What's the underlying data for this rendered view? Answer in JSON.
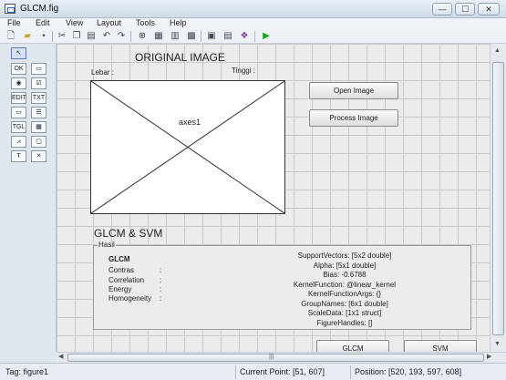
{
  "window": {
    "title": "GLCM.fig",
    "minimize_glyph": "—",
    "maximize_glyph": "☐",
    "close_glyph": "✕"
  },
  "menu": [
    "File",
    "Edit",
    "View",
    "Layout",
    "Tools",
    "Help"
  ],
  "toolbar": {
    "icons": [
      "new-icon",
      "open-icon",
      "save-icon",
      "cut-icon",
      "copy-icon",
      "paste-icon",
      "undo-icon",
      "redo-icon",
      "align-icon",
      "menu-editor-icon",
      "tab-order-icon",
      "toolbar-editor-icon",
      "mfile-editor-icon",
      "property-inspector-icon",
      "object-browser-icon",
      "run-icon"
    ]
  },
  "palette": {
    "items": [
      "select-tool",
      "push-button",
      "slider",
      "radio-button",
      "checkbox",
      "edit-text",
      "static-text",
      "popup-menu",
      "listbox",
      "toggle-button",
      "table",
      "axes",
      "panel",
      "button-group",
      "activex-control"
    ]
  },
  "canvas": {
    "original_image_title": "ORIGINAL IMAGE",
    "lebar_label": "Lebar :",
    "tinggi_label": "Tinggi :",
    "axes_label": "axes1",
    "open_image_button": "Open Image",
    "process_image_button": "Process Image",
    "glcm_svm_title": "GLCM & SVM",
    "hasil_panel": {
      "legend": "Hasil",
      "glcm_heading": "GLCM",
      "features": [
        {
          "name": "Contras",
          "colon": ":"
        },
        {
          "name": "Correlation",
          "colon": ":"
        },
        {
          "name": "Energy",
          "colon": ":"
        },
        {
          "name": "Homogeneity",
          "colon": ":"
        }
      ],
      "svm_lines": [
        "SupportVectors: [5x2 double]",
        "Alpha: [5x1 double]",
        "Bias: -0.6788",
        "KernelFunction: @linear_kernel",
        "KernelFunctionArgs: {}",
        "GroupNames: [6x1 double]",
        "ScaleData: [1x1 struct]",
        "FigureHandles: []"
      ]
    },
    "glcm_button": "GLCM",
    "svm_button": "SVM"
  },
  "statusbar": {
    "tag": "Tag: figure1",
    "current_point": "Current Point:  [51, 607]",
    "position": "Position: [520, 193, 597, 608]"
  },
  "scrollbar": {
    "hscroll_grip": "|||"
  },
  "colors": {
    "grid": "#c9c9c9",
    "canvas": "#ebebeb",
    "run_green": "#1ea31e"
  }
}
